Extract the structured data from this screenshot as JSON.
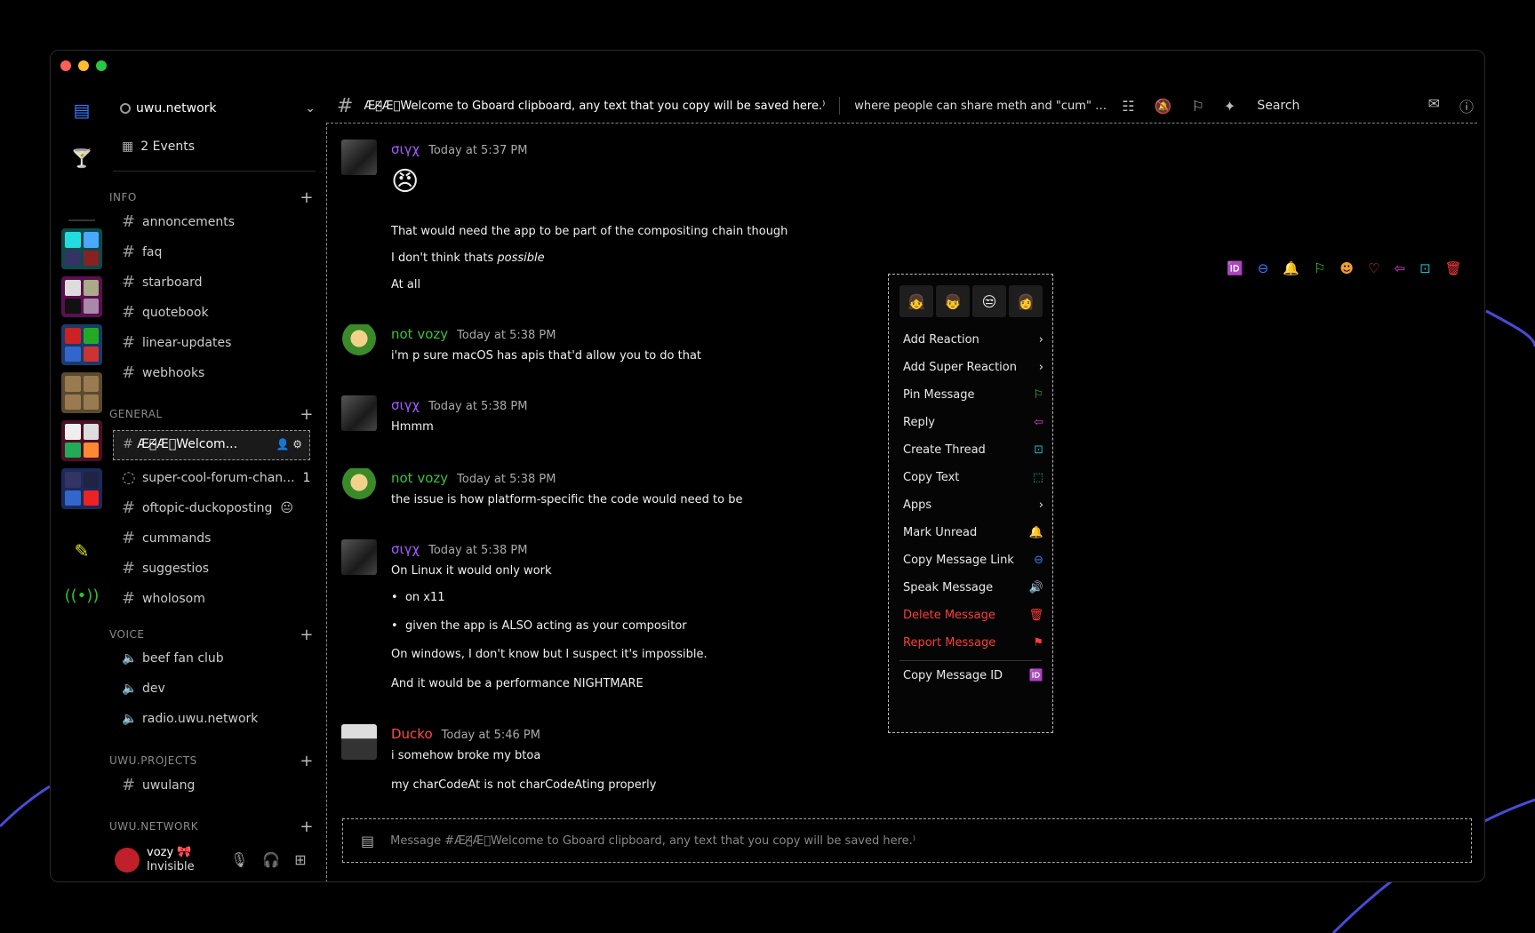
{
  "server": {
    "name": "uwu.network",
    "events": "2 Events"
  },
  "categories": [
    {
      "label": "INFO",
      "channels": [
        "annoncements",
        "faq",
        "starboard",
        "quotebook",
        "linear-updates",
        "webhooks"
      ]
    },
    {
      "label": "GENERAL",
      "active": "Æ⃝̸̵̴Æ⃝Welcom...",
      "channels": [
        "super-cool-forum-chan...",
        "oftopic-duckoposting",
        "cummands",
        "suggestios",
        "wholosom"
      ],
      "forum_count": "1"
    },
    {
      "label": "VOICE",
      "channels": [
        "beef fan club",
        "dev",
        "radio.uwu.network"
      ]
    },
    {
      "label": "UWU.PROJECTS",
      "channels": [
        "uwulang"
      ]
    },
    {
      "label": "UWU.NETWORK",
      "channels": []
    }
  ],
  "user": {
    "name": "vozy",
    "status": "Invisible"
  },
  "header": {
    "title": "Æ⃝̸̵̴Æ⃝Welcome to Gboard clipboard, any text that you copy will be saved here.⁾",
    "topic": "where people can share meth and \"cum\" tog...",
    "search": "Search"
  },
  "messages": [
    {
      "author": "σιγχ",
      "author_color": "#a05cff",
      "time": "Today at 5:37 PM",
      "lines": [
        "That would need the app to be part of the compositing chain though",
        "I don't think thats",
        "possible",
        "At all"
      ]
    },
    {
      "author": "not vozy",
      "author_color": "#3cc23c",
      "time": "Today at 5:38 PM",
      "lines": [
        "i'm p sure macOS has apis that'd allow you to do that"
      ]
    },
    {
      "author": "σιγχ",
      "author_color": "#a05cff",
      "time": "Today at 5:38 PM",
      "lines": [
        "Hmmm"
      ]
    },
    {
      "author": "not vozy",
      "author_color": "#3cc23c",
      "time": "Today at 5:38 PM",
      "lines": [
        "the issue is how platform-specific the code would need to be"
      ]
    },
    {
      "author": "σιγχ",
      "author_color": "#a05cff",
      "time": "Today at 5:38 PM",
      "lines": [
        "On Linux it would only work",
        "on x11",
        "given the app is ALSO acting as your compositor",
        "On windows, I don't know but I suspect it's impossible.",
        "And it would be a performance NIGHTMARE"
      ]
    },
    {
      "author": "Ducko",
      "author_color": "#ff4a4a",
      "time": "Today at 5:46 PM",
      "lines": [
        "i somehow broke my btoa",
        "my charCodeAt is not charCodeAting properly"
      ]
    }
  ],
  "context_menu": [
    {
      "label": "Add Reaction",
      "icon": "chevron-right-icon"
    },
    {
      "label": "Add Super Reaction",
      "icon": "chevron-right-icon"
    },
    {
      "label": "Pin Message",
      "icon": "bookmark-icon",
      "color": "#3cd13c"
    },
    {
      "label": "Reply",
      "icon": "reply-icon",
      "color": "#e040e0"
    },
    {
      "label": "Create Thread",
      "icon": "thread-icon",
      "color": "#22b5c8"
    },
    {
      "label": "Copy Text",
      "icon": "copy-icon",
      "color": "#22b5c8"
    },
    {
      "label": "Apps",
      "icon": "chevron-right-icon"
    },
    {
      "label": "Mark Unread",
      "icon": "bell-icon",
      "color": "#e6e62a"
    },
    {
      "label": "Copy Message Link",
      "icon": "link-icon",
      "color": "#3a7cff"
    },
    {
      "label": "Speak Message",
      "icon": "speaker-icon",
      "color": "#22b5c8"
    },
    {
      "label": "Delete Message",
      "icon": "trash-icon",
      "color": "#ff3b3b",
      "danger": true
    },
    {
      "label": "Report Message",
      "icon": "flag-icon",
      "color": "#ff3b3b",
      "danger": true
    },
    {
      "label": "Copy Message ID",
      "icon": "id-icon",
      "color": "#ddd"
    }
  ],
  "composer": {
    "placeholder": "Message #Æ⃝̸̵̴Æ⃝Welcome to Gboard clipboard, any text that you copy will be saved here.⁾"
  }
}
